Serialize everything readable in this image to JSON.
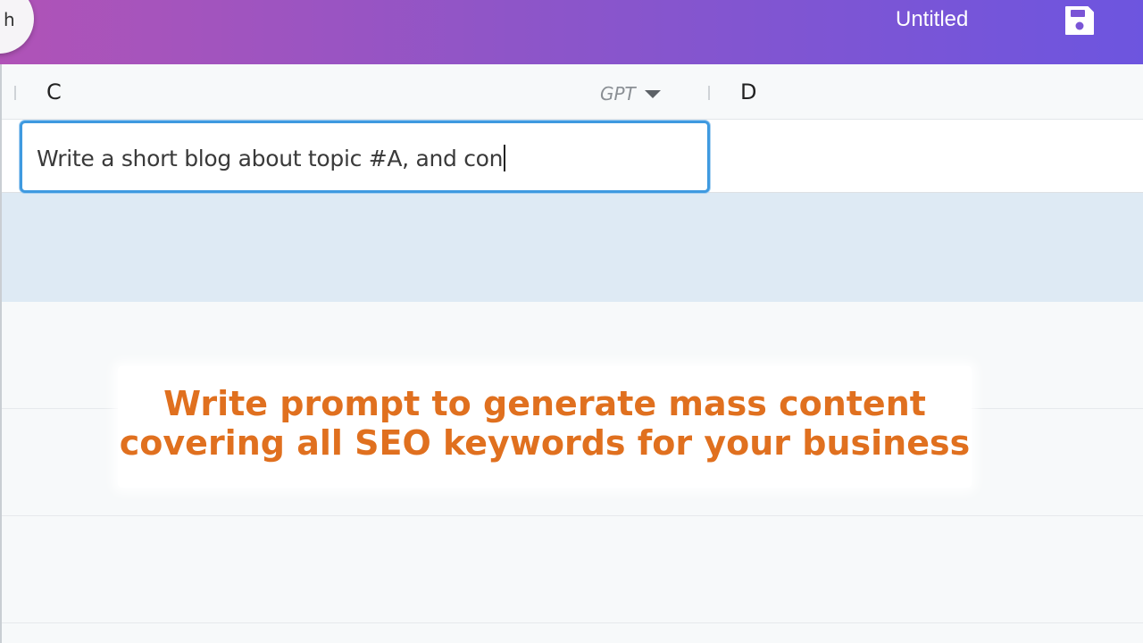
{
  "header": {
    "title": "Untitled",
    "back_glyph": "h",
    "save_icon": "save-icon"
  },
  "columns": {
    "c_label": "C",
    "d_label": "D",
    "model_select": {
      "value": "GPT",
      "icon": "chevron-down-icon"
    }
  },
  "cell": {
    "prompt_value": "Write a short blog about topic #A, and con"
  },
  "caption": {
    "line1": "Write prompt to generate mass content",
    "line2": "covering all SEO keywords for your business",
    "color": "#e0701f"
  },
  "colors": {
    "header_gradient_start": "#b053b7",
    "header_gradient_end": "#6d55df",
    "selected_row": "#deeaf4",
    "input_focus": "#3f9ae0"
  }
}
